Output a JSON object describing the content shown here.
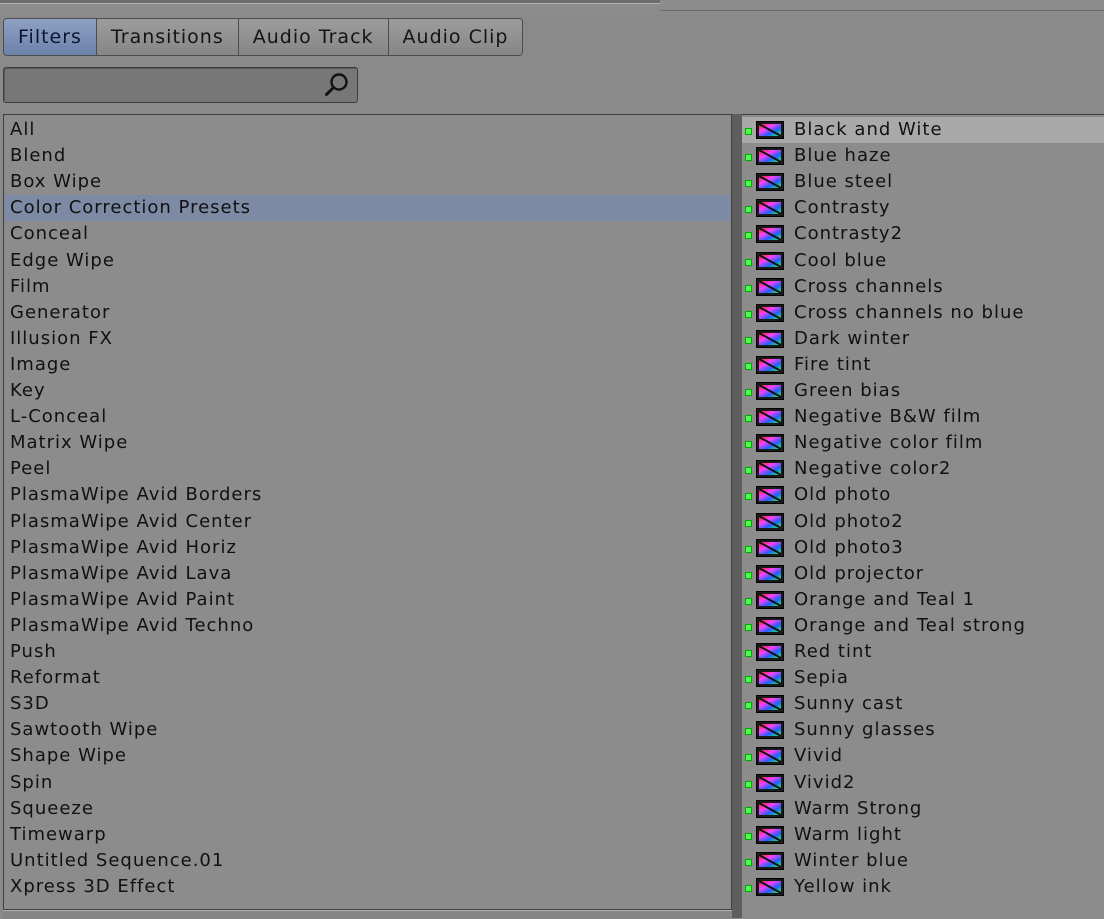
{
  "tabs": [
    {
      "label": "Filters",
      "active": true
    },
    {
      "label": "Transitions",
      "active": false
    },
    {
      "label": "Audio Track",
      "active": false
    },
    {
      "label": "Audio Clip",
      "active": false
    }
  ],
  "search": {
    "value": "",
    "placeholder": "",
    "icon": "search-icon"
  },
  "categories": [
    "All",
    "Blend",
    "Box Wipe",
    "Color Correction Presets",
    "Conceal",
    "Edge Wipe",
    "Film",
    "Generator",
    "Illusion FX",
    "Image",
    "Key",
    "L-Conceal",
    "Matrix Wipe",
    "Peel",
    "PlasmaWipe Avid Borders",
    "PlasmaWipe Avid Center",
    "PlasmaWipe Avid Horiz",
    "PlasmaWipe Avid Lava",
    "PlasmaWipe Avid Paint",
    "PlasmaWipe Avid Techno",
    "Push",
    "Reformat",
    "S3D",
    "Sawtooth Wipe",
    "Shape Wipe",
    "Spin",
    "Squeeze",
    "Timewarp",
    "Untitled Sequence.01",
    "Xpress 3D Effect"
  ],
  "selected_category": "Color Correction Presets",
  "effects": [
    "Black and Wite",
    "Blue haze",
    "Blue steel",
    "Contrasty",
    "Contrasty2",
    "Cool blue",
    "Cross channels",
    "Cross channels no blue",
    "Dark winter",
    "Fire tint",
    "Green bias",
    "Negative B&W film",
    "Negative color film",
    "Negative color2",
    "Old photo",
    "Old photo2",
    "Old photo3",
    "Old projector",
    "Orange and Teal 1",
    "Orange and Teal strong",
    "Red tint",
    "Sepia",
    "Sunny cast",
    "Sunny glasses",
    "Vivid",
    "Vivid2",
    "Warm Strong",
    "Warm light",
    "Winter blue",
    "Yellow ink"
  ],
  "selected_effect": "Black and Wite",
  "effect_icon": "color-effect-icon",
  "colors": {
    "selected_category": "#7c8aa4",
    "active_tab": "#8092b5",
    "status_dot": "#4cff4c"
  }
}
